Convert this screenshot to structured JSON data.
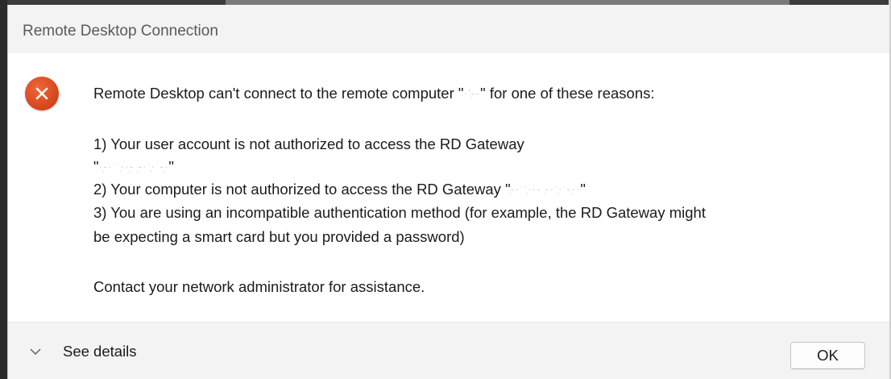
{
  "window": {
    "title": "Remote Desktop Connection"
  },
  "message": {
    "intro_before": "Remote Desktop can't connect to the remote computer \"",
    "intro_redacted": "·'‐̣‐",
    "intro_after": "\" for one of these reasons:",
    "reason1_line1": "1) Your user account is not authorized to access the RD Gateway",
    "reason1_line2_open": "\"",
    "reason1_line2_redacted": "·‐̣·ˑˑ·̣·‐̣ ‐̣·ˑ·̣̣ˑ‐·̣",
    "reason1_line2_close": "\"",
    "reason2_before": "2) Your computer is not authorized to access the RD Gateway \"",
    "reason2_redacted": "‐̣·ˑˑ·̣·‐ ‐̣·ˑ·̣̣ˑ‐·̣·",
    "reason2_after": "\"",
    "reason3_line1": "3) You are using an incompatible authentication method (for example, the RD Gateway might",
    "reason3_line2": "be expecting a smart card but you provided a password)",
    "contact": "Contact your network administrator for assistance."
  },
  "footer": {
    "details_label": "See details",
    "ok_label": "OK"
  },
  "icons": {
    "error": "error-x-icon",
    "chevron": "chevron-down-icon"
  },
  "colors": {
    "error_icon": "#d5441c",
    "titlebar_bg": "#f3f3f3",
    "footer_bg": "#f3f3f3"
  }
}
